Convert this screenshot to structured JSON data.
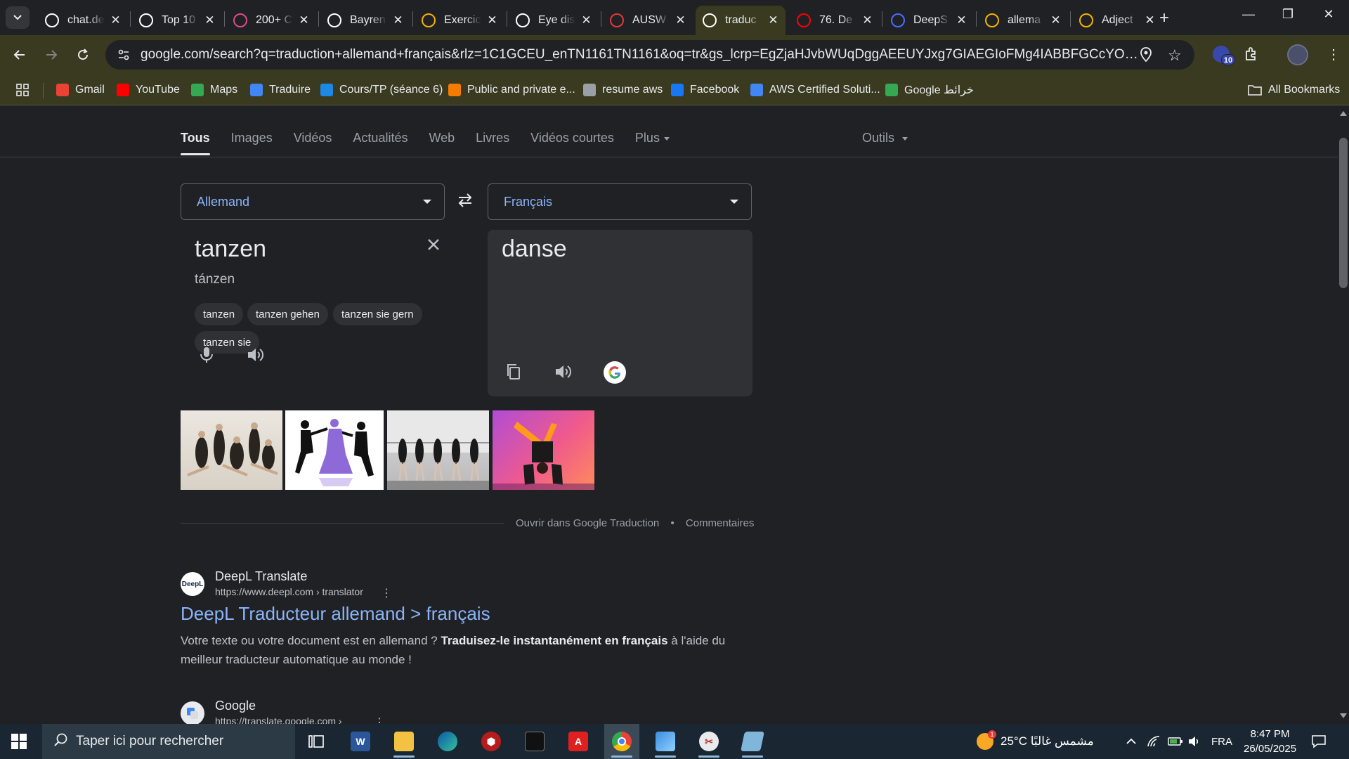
{
  "tabs": [
    {
      "title": "chat.de",
      "icon": "openai-icon",
      "color": "#ffffff"
    },
    {
      "title": "Top 10",
      "icon": "notion-icon",
      "color": "#ffffff"
    },
    {
      "title": "200+ C",
      "icon": "colorful-circle-icon",
      "color": "#e04a8a"
    },
    {
      "title": "Bayren",
      "icon": "github-icon",
      "color": "#ffffff"
    },
    {
      "title": "Exercic",
      "icon": "pencil-note-icon",
      "color": "#f4b400"
    },
    {
      "title": "Eye dis",
      "icon": "openai-icon",
      "color": "#ffffff"
    },
    {
      "title": "AUSW",
      "icon": "g-red-icon",
      "color": "#e53935"
    },
    {
      "title": "traduc",
      "icon": "google-icon",
      "color": "#ffffff",
      "active": true
    },
    {
      "title": "76. De",
      "icon": "youtube-icon",
      "color": "#ff0000"
    },
    {
      "title": "DeepS",
      "icon": "deepseek-icon",
      "color": "#4d6bfe"
    },
    {
      "title": "allema",
      "icon": "grid-colorful-icon",
      "color": "#f4b400"
    },
    {
      "title": "Adject",
      "icon": "grid-colorful-icon",
      "color": "#f4b400"
    }
  ],
  "toolbar": {
    "url": "google.com/search?q=traduction+allemand+français&rlz=1C1GCEU_enTN1161TN1161&oq=tr&gs_lcrp=EgZjaHJvbWUqDggAEEUYJxg7GIAEGIoFMg4IABBFGCcYOxiABBiKBTIGCAEQ...",
    "extension_badge": "10"
  },
  "bookmarks": [
    {
      "label": "Gmail",
      "icon": "gmail-icon",
      "color": "#ea4335"
    },
    {
      "label": "YouTube",
      "icon": "youtube-icon",
      "color": "#ff0000"
    },
    {
      "label": "Maps",
      "icon": "maps-pin-icon",
      "color": "#34a853"
    },
    {
      "label": "Traduire",
      "icon": "translate-icon",
      "color": "#4285f4"
    },
    {
      "label": "Cours/TP (séance 6)",
      "icon": "classroom-icon",
      "color": "#1e88e5"
    },
    {
      "label": "Public and private e...",
      "icon": "p-icon",
      "color": "#f57c00"
    },
    {
      "label": "resume aws",
      "icon": "globe-icon",
      "color": "#9aa0a6"
    },
    {
      "label": "Facebook",
      "icon": "facebook-icon",
      "color": "#1877f2"
    },
    {
      "label": "AWS Certified Soluti...",
      "icon": "stack-icon",
      "color": "#4285f4"
    },
    {
      "label": "Google خرائط",
      "icon": "maps-pin-icon",
      "color": "#34a853"
    }
  ],
  "all_bookmarks": "All Bookmarks",
  "search_tabs": [
    "Tous",
    "Images",
    "Vidéos",
    "Actualités",
    "Web",
    "Livres",
    "Vidéos courtes",
    "Plus"
  ],
  "tools_label": "Outils",
  "translator": {
    "source_lang": "Allemand",
    "target_lang": "Français",
    "source_text": "tanzen",
    "source_phonetic": "tánzen",
    "chips": [
      "tanzen",
      "tanzen gehen",
      "tanzen sie gern",
      "tanzen sie"
    ],
    "target_text": "danse"
  },
  "footer": {
    "open_link": "Ouvrir dans Google Traduction",
    "separator": "•",
    "feedback": "Commentaires"
  },
  "results": [
    {
      "site": "DeepL Translate",
      "url": "https://www.deepl.com › translator",
      "title": "DeepL Traducteur allemand > français",
      "snippet_a": "Votre texte ou votre document est en allemand ? ",
      "snippet_bold": "Traduisez-le instantanément en français",
      "snippet_b": " à l'aide du meilleur traducteur automatique au monde !",
      "favicon": "DeepL"
    },
    {
      "site": "Google",
      "url": "https://translate.google.com ›"
    }
  ],
  "taskbar": {
    "search_placeholder": "Taper ici pour rechercher",
    "weather": "25°C  مشمس غالبًا",
    "lang": "FRA",
    "time": "8:47 PM",
    "date": "26/05/2025"
  }
}
